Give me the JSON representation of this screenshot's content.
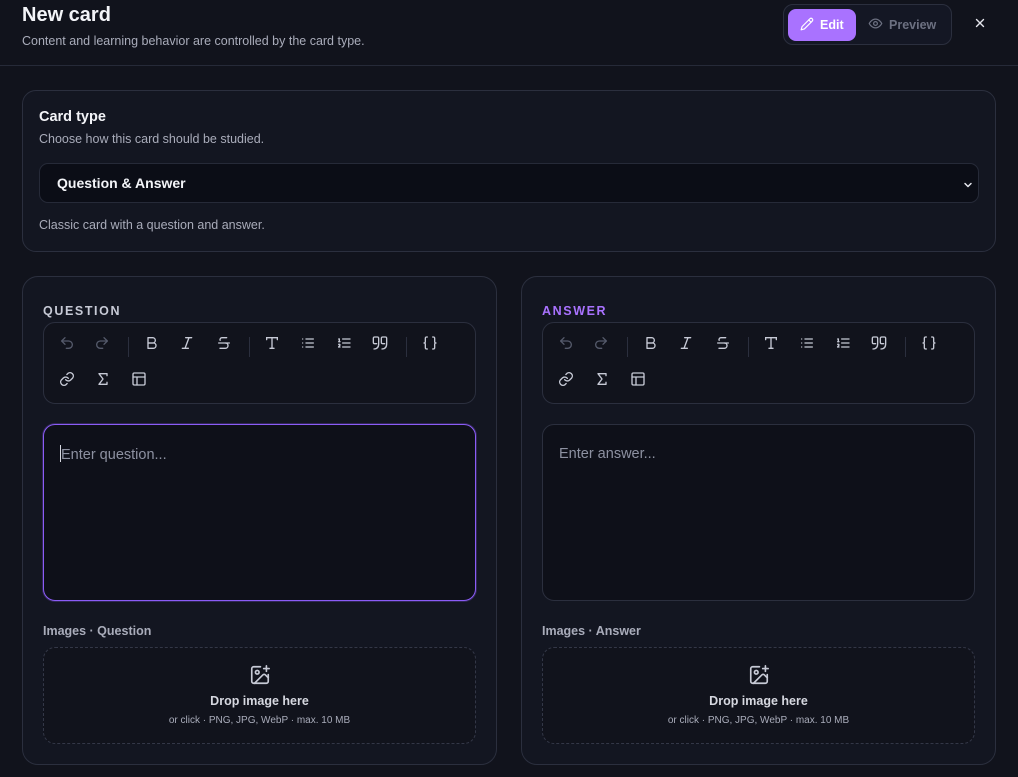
{
  "header": {
    "title": "New card",
    "subtitle": "Content and learning behavior are controlled by the card type.",
    "mode": {
      "edit": "Edit",
      "preview": "Preview",
      "active": "edit"
    }
  },
  "card_type": {
    "title": "Card type",
    "subtitle": "Choose how this card should be studied.",
    "selected": "Question & Answer",
    "description": "Classic card with a question and answer."
  },
  "question": {
    "label": "QUESTION",
    "placeholder": "Enter question...",
    "images_label": "Images · Question",
    "drop_title": "Drop image here",
    "drop_sub": "or click · PNG, JPG, WebP · max. 10 MB"
  },
  "answer": {
    "label": "ANSWER",
    "placeholder": "Enter answer...",
    "images_label": "Images · Answer",
    "drop_title": "Drop image here",
    "drop_sub": "or click · PNG, JPG, WebP · max. 10 MB"
  },
  "toolbar_icons": [
    "undo-icon",
    "redo-icon",
    "bold-icon",
    "italic-icon",
    "strikethrough-icon",
    "text-type-icon",
    "bullet-list-icon",
    "numbered-list-icon",
    "quote-icon",
    "code-icon",
    "link-icon",
    "formula-icon",
    "table-icon"
  ],
  "colors": {
    "accent": "#a972ff",
    "background": "#11131c",
    "panel": "#131621",
    "border": "#2b2f3e"
  }
}
